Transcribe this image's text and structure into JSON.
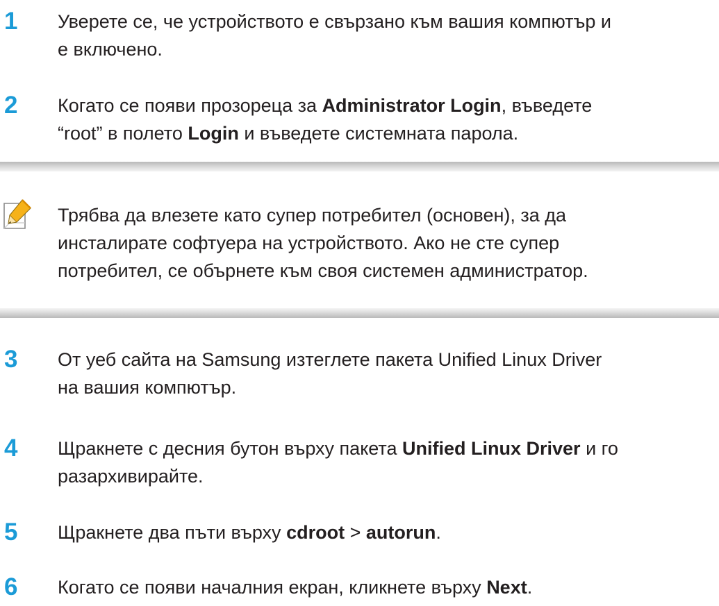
{
  "steps": [
    {
      "number": "1",
      "lines": [
        [
          "Уверете се, че устройството е свързано към вашия компютър и"
        ],
        [
          "е включено."
        ]
      ]
    },
    {
      "number": "2",
      "seg": {
        "a": "Когато се появи прозореца за ",
        "b": "Administrator Login",
        "c": ", въведете",
        "d": "“root” в полето ",
        "e": "Login",
        "f": " и въведете системната парола."
      }
    },
    {
      "number": "3",
      "line1": "От уеб сайта на Samsung изтеглете пакета Unified Linux Driver",
      "line2": "на вашия компютър."
    },
    {
      "number": "4",
      "seg": {
        "a": "Щракнете с десния бутон върху пакета ",
        "b": "Unified Linux Driver",
        "c": " и го",
        "d": "разархивирайте."
      }
    },
    {
      "number": "5",
      "seg": {
        "a": "Щракнете два пъти върху ",
        "b": "cdroot",
        "c": " > ",
        "d": "autorun",
        "e": "."
      }
    },
    {
      "number": "6",
      "seg": {
        "a": "Когато се появи началния екран, кликнете върху ",
        "b": "Next",
        "c": "."
      }
    }
  ],
  "note": {
    "icon": "note-pencil-icon",
    "line1": "Трябва да влезете като супер потребител (основен), за да",
    "line2": "инсталирате софтуера на устройството. Ако не сте супер",
    "line3": "потребител, се обърнете към своя системен администратор."
  },
  "colors": {
    "step_number": "#1b9bd7",
    "text": "#231f20",
    "note_bar": "#c4c4c4",
    "pencil": "#f6b21a"
  }
}
